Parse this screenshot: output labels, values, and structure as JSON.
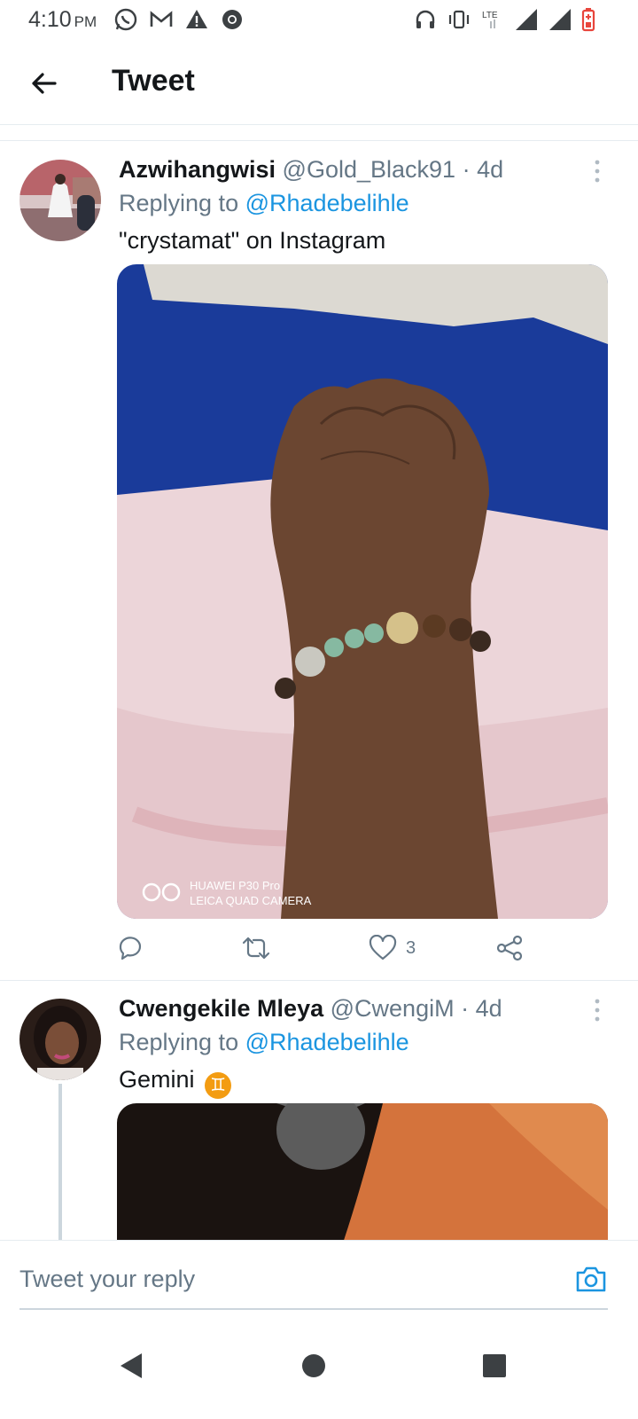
{
  "status_bar": {
    "time": "4:10",
    "ampm": "PM",
    "network_label": "LTE",
    "left_icons": [
      "whatsapp-icon",
      "gmail-icon",
      "warning-icon",
      "chrome-icon"
    ],
    "right_icons": [
      "headphones-icon",
      "vibrate-icon",
      "lte-icon",
      "signal-icon",
      "signal-icon",
      "battery-icon"
    ]
  },
  "app_bar": {
    "title": "Tweet",
    "back_icon": "arrow-left-icon"
  },
  "tweets": [
    {
      "name": "Azwihangwisi",
      "handle": "@Gold_Black91",
      "dot": "·",
      "time": "4d",
      "replying_prefix": "Replying to",
      "replying_to": "@Rhadebelihle",
      "text": "\"crystamat\" on Instagram",
      "media_watermark_line1": "HUAWEI P30 Pro",
      "media_watermark_line2": "LEICA QUAD CAMERA",
      "likes": "3"
    },
    {
      "name": "Cwengekile Mleya",
      "handle": "@CwengiM",
      "dot": "·",
      "time": "4d",
      "replying_prefix": "Replying to",
      "replying_to": "@Rhadebelihle",
      "text": "Gemini",
      "emoji": "♊"
    }
  ],
  "reply_bar": {
    "placeholder": "Tweet your reply"
  },
  "colors": {
    "link": "#1b95e0",
    "muted": "#657786",
    "text": "#14171a"
  }
}
